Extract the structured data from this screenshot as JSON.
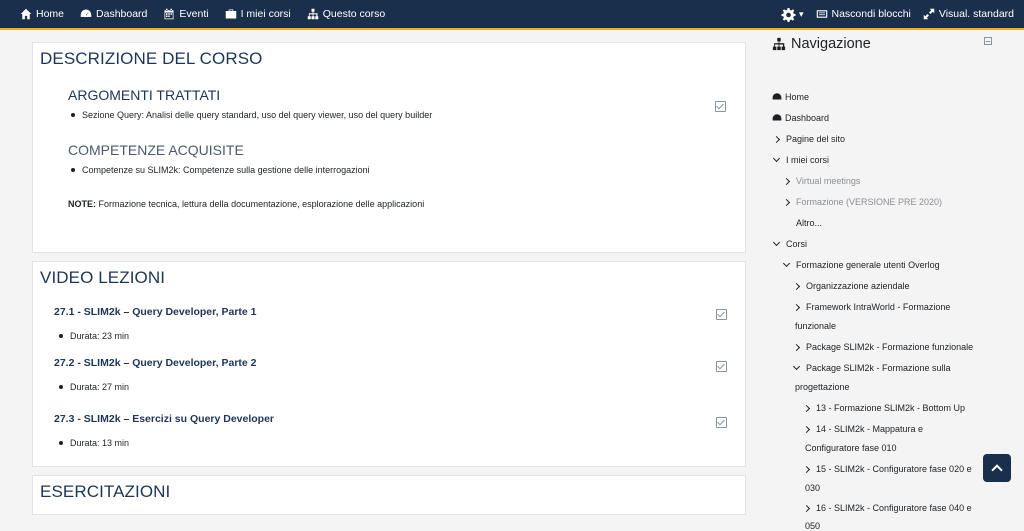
{
  "topnav": {
    "home": "Home",
    "dashboard": "Dashboard",
    "eventi": "Eventi",
    "miei_corsi": "I miei corsi",
    "questo_corso": "Questo corso",
    "settings_icon": "gear-icon",
    "hide_blocks": "Nascondi blocchi",
    "standard_view": "Visual. standard"
  },
  "descrizione": {
    "title": "DESCRIZIONE DEL CORSO",
    "argomenti_title": "ARGOMENTI TRATTATI",
    "argomenti_item": "Sezione Query: Analisi delle query standard, uso del query viewer, uso del query builder",
    "competenze_title": "COMPETENZE ACQUISITE",
    "competenze_item": "Competenze su SLIM2k: Competenze sulla gestione delle interrogazioni",
    "note_label": "NOTE:",
    "note_text": " Formazione tecnica, lettura della documentazione, esplorazione delle applicazioni"
  },
  "video": {
    "title": "VIDEO LEZIONI",
    "lessons": [
      {
        "title": "27.1 - SLIM2k – Query Developer, Parte 1",
        "duration": "Durata: 23 min"
      },
      {
        "title": "27.2 - SLIM2k – Query Developer, Parte 2",
        "duration": "Durata: 27 min"
      },
      {
        "title": "27.3 - SLIM2k – Esercizi su Query Developer",
        "duration": "Durata: 13 min"
      }
    ]
  },
  "esercitazioni": {
    "title": "ESERCITAZIONI"
  },
  "sidebar": {
    "title": "Navigazione",
    "items": {
      "home": "Home",
      "dashboard": "Dashboard",
      "pagine": "Pagine del sito",
      "miei_corsi": "I miei corsi",
      "virtual": "Virtual meetings",
      "formazione_pre": "Formazione (VERSIONE PRE 2020)",
      "altro": "Altro...",
      "corsi": "Corsi",
      "formazione_generale": "Formazione generale utenti Overlog",
      "organizzazione": "Organizzazione aziendale",
      "framework_1": "Framework IntraWorld - Formazione",
      "framework_2": "funzionale",
      "package_funz": "Package SLIM2k - Formazione funzionale",
      "package_prog_1": "Package SLIM2k - Formazione sulla",
      "package_prog_2": "progettazione",
      "c13": "13 - Formazione SLIM2k - Bottom Up",
      "c14_1": "14 - SLIM2k - Mappatura e",
      "c14_2": "Configuratore fase 010",
      "c15_1": "15 - SLIM2k - Configuratore fase 020 e",
      "c15_2": "030",
      "c16_1": "16 - SLIM2k - Configuratore fase 040 e",
      "c16_2": "050"
    }
  }
}
